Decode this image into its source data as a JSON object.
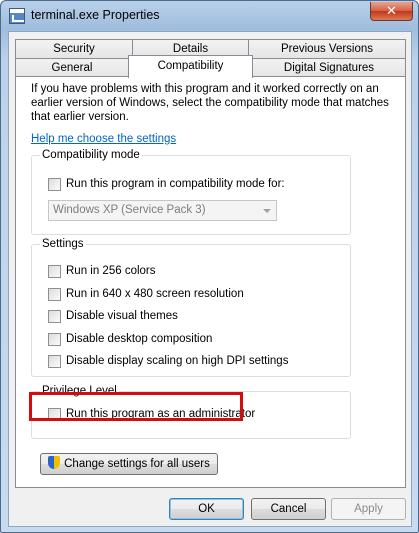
{
  "window": {
    "title": "terminal.exe Properties",
    "close_glyph": "✕"
  },
  "tabs": {
    "row1": [
      "Security",
      "Details",
      "Previous Versions"
    ],
    "row2": [
      "General",
      "Compatibility",
      "Digital Signatures"
    ],
    "active": "Compatibility"
  },
  "page": {
    "intro": "If you have problems with this program and it worked correctly on an earlier version of Windows, select the compatibility mode that matches that earlier version.",
    "help_link": "Help me choose the settings"
  },
  "compat_mode": {
    "title": "Compatibility mode",
    "checkbox_label": "Run this program in compatibility mode for:",
    "checked": false,
    "select_value": "Windows XP (Service Pack 3)",
    "select_enabled": false
  },
  "settings": {
    "title": "Settings",
    "items": [
      {
        "label": "Run in 256 colors",
        "checked": false
      },
      {
        "label": "Run in 640 x 480 screen resolution",
        "checked": false
      },
      {
        "label": "Disable visual themes",
        "checked": false
      },
      {
        "label": "Disable desktop composition",
        "checked": false
      },
      {
        "label": "Disable display scaling on high DPI settings",
        "checked": false
      }
    ]
  },
  "privilege": {
    "title": "Privilege Level",
    "checkbox_label": "Run this program as an administrator",
    "checked": false,
    "highlight_color": "#d50c0c"
  },
  "buttons": {
    "change_all_users": "Change settings for all users",
    "ok": "OK",
    "cancel": "Cancel",
    "apply": "Apply"
  },
  "icons": {
    "title_icon": "application-window-icon",
    "uac_shield": "uac-shield-icon"
  }
}
